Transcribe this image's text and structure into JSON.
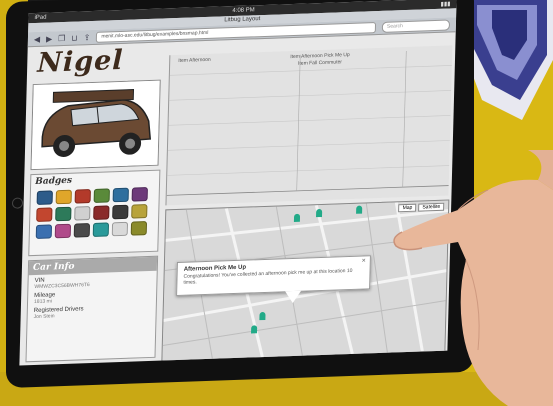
{
  "statusbar": {
    "device": "iPad",
    "time": "4:08 PM"
  },
  "browser": {
    "page_title": "Litbug Layout",
    "url": "menit.mlo-asc.edu/litbug/examples/bnsmap.html",
    "search_placeholder": "Search"
  },
  "page": {
    "title": "Nigel"
  },
  "badges": {
    "heading": "Badges",
    "colors": [
      "#2d5b8a",
      "#e0a62a",
      "#b33a2a",
      "#5a8a3a",
      "#2f6f9e",
      "#6d3a7a",
      "#c2462f",
      "#2d7a5a",
      "#d0d0d0",
      "#8a2a2a",
      "#3a3a3a",
      "#b8a33a",
      "#3a6fb0",
      "#b04a8a",
      "#4a4a4a",
      "#2a9a9a",
      "#d9d9d9",
      "#8a8a2a"
    ]
  },
  "car_info": {
    "heading": "Car Info",
    "vin_label": "VIN",
    "vin_value": "WMWZC3C56BWH76T6",
    "mileage_label": "Mileage",
    "mileage_value": "1813 mi",
    "drivers_label": "Registered Drivers",
    "drivers_value": "Jon Stein"
  },
  "chart": {
    "top_left_label": "Item Afternoon",
    "top_mid_label": "Item Afternoon Pick Me Up",
    "mid_label": "Item Fall Commuter"
  },
  "map": {
    "btn_map": "Map",
    "btn_satellite": "Satellite"
  },
  "popup": {
    "title": "Afternoon Pick Me Up",
    "text": "Congratulations! You've collected an afternoon pick me up at this location 10 times.",
    "close": "×"
  }
}
